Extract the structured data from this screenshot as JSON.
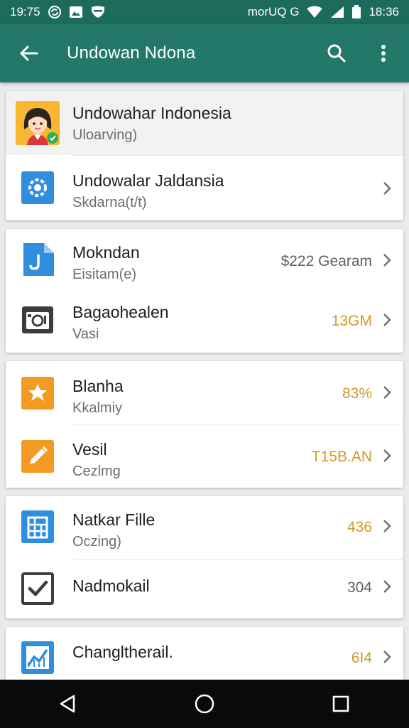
{
  "status_bar": {
    "time_left": "19:75",
    "carrier": "morUQ G",
    "time_right": "18:36",
    "icons": [
      "sync-icon",
      "image-icon",
      "shield-icon",
      "wifi-icon",
      "signal-icon",
      "battery-icon"
    ]
  },
  "app_bar": {
    "title": "Undowan Ndona",
    "icons": [
      "back-arrow-icon",
      "search-icon",
      "more-vert-icon"
    ]
  },
  "colors": {
    "status_bar": "#1d6b5d",
    "app_bar": "#23786a",
    "value_amber": "#d29a20",
    "value_gray": "#5f5f5f",
    "icon_blue": "#2f8ee0",
    "icon_orange": "#f29a21",
    "icon_dark": "#3d3d3d"
  },
  "groups": [
    {
      "items": [
        {
          "title": "Undowahar Indonesia",
          "subtitle": "Uloarving)",
          "value": "",
          "icon": "avatar-icon"
        },
        {
          "title": "Undowalar Jaldansia",
          "subtitle": "Skdarna(t/t)",
          "value": "",
          "icon": "settings-gear-icon"
        }
      ]
    },
    {
      "items": [
        {
          "title": "Mokndan",
          "subtitle": "Eisitam(e)",
          "value": "$222 Gearam",
          "icon": "file-icon"
        },
        {
          "title": "Bagaohealen",
          "subtitle": "Vasi",
          "value": "13GM",
          "icon": "camera-icon"
        }
      ]
    },
    {
      "items": [
        {
          "title": "Blanha",
          "subtitle": "Kkalmiy",
          "value": "83%",
          "icon": "star-icon"
        },
        {
          "title": "Vesil",
          "subtitle": "Cezlmg",
          "value": "T15B.AN",
          "icon": "edit-icon"
        }
      ]
    },
    {
      "items": [
        {
          "title": "Natkar Fille",
          "subtitle": "Oczing)",
          "value": "436",
          "icon": "grid-file-icon"
        },
        {
          "title": "Nadmokail",
          "subtitle": "",
          "value": "304",
          "icon": "checkbox-icon"
        }
      ]
    },
    {
      "items": [
        {
          "title": "Changltherail.",
          "subtitle": "",
          "value": "6I4",
          "icon": "chart-icon"
        }
      ]
    }
  ],
  "nav_bar": {
    "icons": [
      "back-triangle-icon",
      "home-circle-icon",
      "recents-square-icon"
    ]
  }
}
